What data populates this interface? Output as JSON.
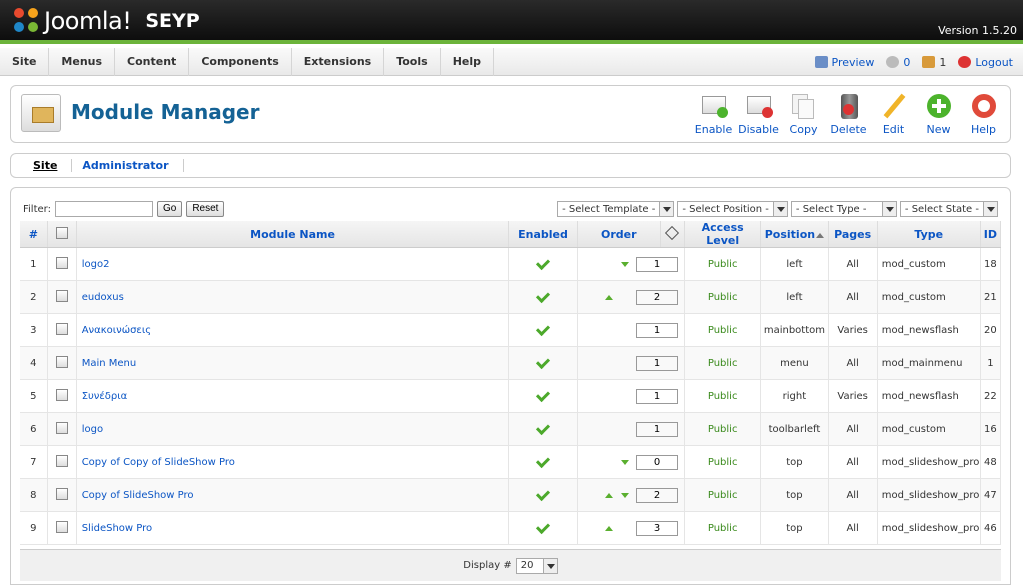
{
  "header": {
    "brand": "Joomla!",
    "site_name": "SEYP",
    "version": "Version 1.5.20"
  },
  "menu": [
    "Site",
    "Menus",
    "Content",
    "Components",
    "Extensions",
    "Tools",
    "Help"
  ],
  "status": {
    "preview": "Preview",
    "messages": "0",
    "users": "1",
    "logout": "Logout"
  },
  "page": {
    "title": "Module Manager"
  },
  "toolbar": [
    "Enable",
    "Disable",
    "Copy",
    "Delete",
    "Edit",
    "New",
    "Help"
  ],
  "tabs": [
    "Site",
    "Administrator"
  ],
  "filter": {
    "label": "Filter:",
    "value": "",
    "go": "Go",
    "reset": "Reset"
  },
  "selects": [
    "- Select Template -",
    "- Select Position -",
    "- Select Type -",
    "- Select State -"
  ],
  "columns": [
    "#",
    "Module Name",
    "Enabled",
    "Order",
    "Access Level",
    "Position",
    "Pages",
    "Type",
    "ID"
  ],
  "rows": [
    {
      "num": "1",
      "name": "logo2",
      "order": "1",
      "up": false,
      "down": true,
      "access": "Public",
      "position": "left",
      "pages": "All",
      "type": "mod_custom",
      "id": "18"
    },
    {
      "num": "2",
      "name": "eudoxus",
      "order": "2",
      "up": true,
      "down": false,
      "access": "Public",
      "position": "left",
      "pages": "All",
      "type": "mod_custom",
      "id": "21"
    },
    {
      "num": "3",
      "name": "Ανακοινώσεις",
      "order": "1",
      "up": false,
      "down": false,
      "access": "Public",
      "position": "mainbottom",
      "pages": "Varies",
      "type": "mod_newsflash",
      "id": "20"
    },
    {
      "num": "4",
      "name": "Main Menu",
      "order": "1",
      "up": false,
      "down": false,
      "access": "Public",
      "position": "menu",
      "pages": "All",
      "type": "mod_mainmenu",
      "id": "1"
    },
    {
      "num": "5",
      "name": "Συνέδρια",
      "order": "1",
      "up": false,
      "down": false,
      "access": "Public",
      "position": "right",
      "pages": "Varies",
      "type": "mod_newsflash",
      "id": "22"
    },
    {
      "num": "6",
      "name": "logo",
      "order": "1",
      "up": false,
      "down": false,
      "access": "Public",
      "position": "toolbarleft",
      "pages": "All",
      "type": "mod_custom",
      "id": "16"
    },
    {
      "num": "7",
      "name": "Copy of Copy of SlideShow Pro",
      "order": "0",
      "up": false,
      "down": true,
      "access": "Public",
      "position": "top",
      "pages": "All",
      "type": "mod_slideshow_pro",
      "id": "48"
    },
    {
      "num": "8",
      "name": "Copy of SlideShow Pro",
      "order": "2",
      "up": true,
      "down": true,
      "access": "Public",
      "position": "top",
      "pages": "All",
      "type": "mod_slideshow_pro",
      "id": "47"
    },
    {
      "num": "9",
      "name": "SlideShow Pro",
      "order": "3",
      "up": true,
      "down": false,
      "access": "Public",
      "position": "top",
      "pages": "All",
      "type": "mod_slideshow_pro",
      "id": "46"
    }
  ],
  "footer": {
    "display_label": "Display #",
    "display_value": "20"
  }
}
